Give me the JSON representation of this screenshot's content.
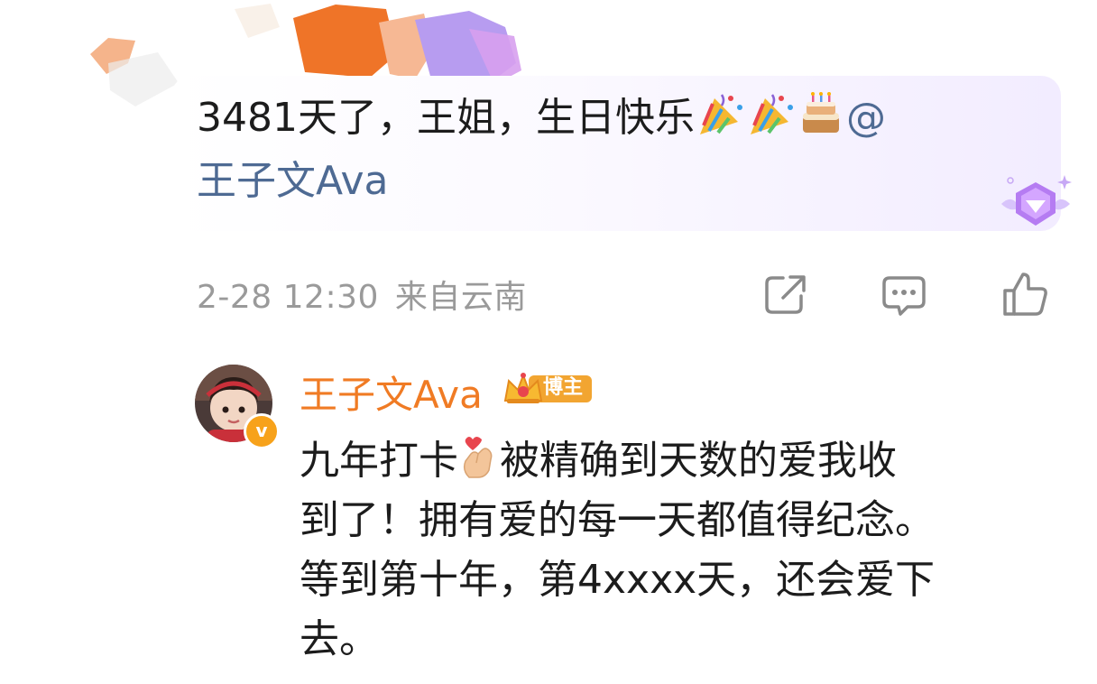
{
  "comment": {
    "line1_text": "3481天了，王姐，生日快乐",
    "emojis": [
      "party-popper-icon",
      "party-popper-icon",
      "birthday-cake-icon"
    ],
    "mention_at": "@",
    "mention_name": "王子文Ava",
    "timestamp": "2-28 12:30",
    "location": "来自云南",
    "bubble_badge": "diamond-badge-icon"
  },
  "actions": {
    "share": "share-icon",
    "reply": "comment-icon",
    "like": "thumbs-up-icon"
  },
  "reply": {
    "author": "王子文Ava",
    "author_verified": "v",
    "author_badge": "博主",
    "author_badge_icon": "crown-icon",
    "text_line1_before": "九年打卡",
    "text_line1_after": "被精确到天数的爱我收",
    "text_line2": "到了！拥有爱的每一天都值得纪念。",
    "text_line3": "等到第十年，第4xxxx天，还会爱下",
    "text_line4": "去。",
    "emoji": "finger-heart-icon"
  },
  "colors": {
    "mention": "#4e6a93",
    "author": "#f07b24",
    "meta": "#9a9a9a",
    "badge": "#f7a21b"
  }
}
